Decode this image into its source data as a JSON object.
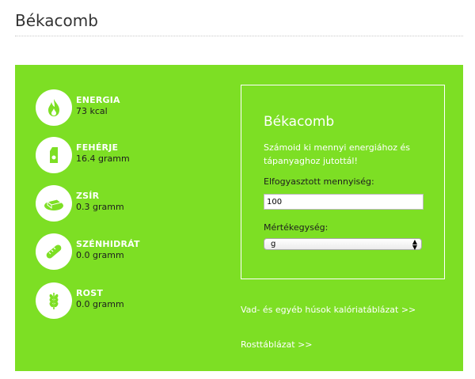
{
  "page": {
    "title": "Békacomb"
  },
  "nutrients": [
    {
      "name": "ENERGIA",
      "value": "73 kcal",
      "icon": "flame-icon"
    },
    {
      "name": "FEHÉRJE",
      "value": "16.4 gramm",
      "icon": "milk-carton-icon"
    },
    {
      "name": "ZSÍR",
      "value": "0.3 gramm",
      "icon": "butter-icon"
    },
    {
      "name": "SZÉNHIDRÁT",
      "value": "0.0 gramm",
      "icon": "bread-icon"
    },
    {
      "name": "ROST",
      "value": "0.0 gramm",
      "icon": "wheat-icon"
    }
  ],
  "calculator": {
    "title": "Békacomb",
    "description": "Számoid ki mennyi energiához és tápanyaghoz jutottál!",
    "quantity_label": "Elfogyasztott mennyiség:",
    "quantity_value": "100",
    "unit_label": "Mértékegység:",
    "unit_value": "g"
  },
  "links": {
    "game_table": "Vad- és egyéb húsok kalóriatáblázat >>",
    "fiber_table": "Rosttáblázat >>"
  },
  "colors": {
    "panel": "#7ddf24",
    "text_light": "#ffffff",
    "text_dark": "#1e1e1e"
  }
}
